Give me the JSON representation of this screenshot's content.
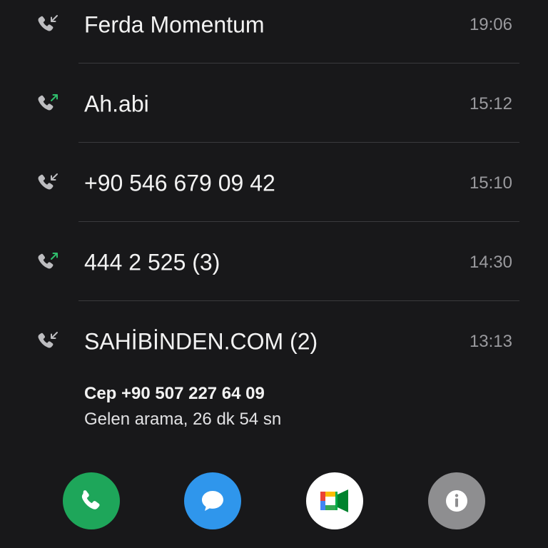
{
  "calls": [
    {
      "name": "Ferda Momentum",
      "time": "19:06",
      "direction": "incoming",
      "icon": "incoming-call-icon"
    },
    {
      "name": "Ah.abi",
      "time": "15:12",
      "direction": "outgoing",
      "icon": "outgoing-call-icon"
    },
    {
      "name": "+90 546 679 09 42",
      "time": "15:10",
      "direction": "incoming",
      "icon": "incoming-call-icon"
    },
    {
      "name": "444 2 525 (3)",
      "time": "14:30",
      "direction": "outgoing",
      "icon": "outgoing-call-icon"
    },
    {
      "name": "SAHİBİNDEN.COM (2)",
      "time": "13:13",
      "direction": "incoming",
      "icon": "incoming-call-icon"
    }
  ],
  "expanded": {
    "number_line": "Cep +90 507 227 64 09",
    "summary_line": "Gelen arama, 26 dk 54 sn"
  },
  "actions": [
    {
      "icon": "phone-icon",
      "color": "#1ea65a"
    },
    {
      "icon": "message-bubble-icon",
      "color": "#2f96ec"
    },
    {
      "icon": "google-meet-icon",
      "color": "#ffffff"
    },
    {
      "icon": "info-icon",
      "color": "#8e8e90"
    }
  ],
  "colors": {
    "background": "#18181a",
    "divider": "#3a3a3d",
    "outgoing_arrow": "#2fbf6c",
    "icon_gray": "#bdbdc0",
    "time_text": "#9a9a9e"
  }
}
